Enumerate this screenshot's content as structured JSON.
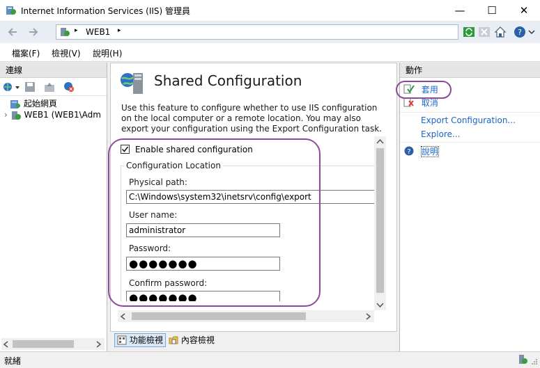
{
  "window": {
    "title": "Internet Information Services (IIS) 管理員",
    "min_glyph": "—",
    "max_glyph": "☐",
    "close_glyph": "✕"
  },
  "address": {
    "separator": "▸",
    "path": "WEB1"
  },
  "menu": [
    "檔案(F)",
    "檢視(V)",
    "說明(H)"
  ],
  "connections": {
    "title": "連線",
    "tree": [
      {
        "label": "起始網頁"
      },
      {
        "label": "WEB1 (WEB1\\Adm",
        "expander": "›"
      }
    ]
  },
  "feature": {
    "title": "Shared Configuration",
    "description": "Use this feature to configure whether to use IIS configuration on the local computer or a remote location. You may also export your configuration using the Export Configuration task.",
    "enable_label": "Enable shared configuration",
    "enable_checked": true,
    "group_label": "Configuration Location",
    "physical_path_label": "Physical path:",
    "physical_path_value": "C:\\Windows\\system32\\inetsrv\\config\\export",
    "username_label": "User name:",
    "username_value": "administrator",
    "password_label": "Password:",
    "password_value": "●●●●●●●",
    "confirm_label": "Confirm password:",
    "confirm_value": "●●●●●●●"
  },
  "views": {
    "features_view": "功能檢視",
    "content_view": "內容檢視"
  },
  "actions": {
    "title": "動作",
    "apply": "套用",
    "cancel": "取消",
    "export": "Export Configuration...",
    "explore": "Explore...",
    "help": "說明"
  },
  "status": {
    "text": "就緒"
  },
  "colors": {
    "highlight": "#8b4a9c",
    "link": "#1a66c8"
  }
}
